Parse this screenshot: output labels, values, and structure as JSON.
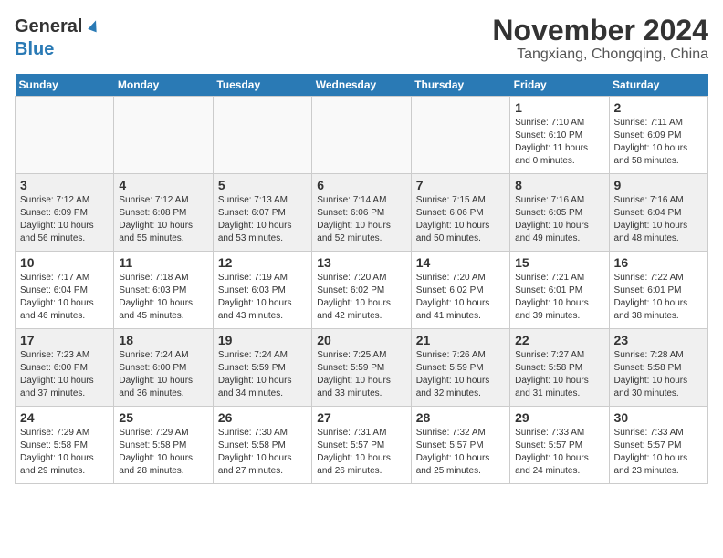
{
  "header": {
    "logo_general": "General",
    "logo_blue": "Blue",
    "title": "November 2024",
    "location": "Tangxiang, Chongqing, China"
  },
  "calendar": {
    "days_of_week": [
      "Sunday",
      "Monday",
      "Tuesday",
      "Wednesday",
      "Thursday",
      "Friday",
      "Saturday"
    ],
    "weeks": [
      [
        {
          "day": "",
          "info": ""
        },
        {
          "day": "",
          "info": ""
        },
        {
          "day": "",
          "info": ""
        },
        {
          "day": "",
          "info": ""
        },
        {
          "day": "",
          "info": ""
        },
        {
          "day": "1",
          "info": "Sunrise: 7:10 AM\nSunset: 6:10 PM\nDaylight: 11 hours\nand 0 minutes."
        },
        {
          "day": "2",
          "info": "Sunrise: 7:11 AM\nSunset: 6:09 PM\nDaylight: 10 hours\nand 58 minutes."
        }
      ],
      [
        {
          "day": "3",
          "info": "Sunrise: 7:12 AM\nSunset: 6:09 PM\nDaylight: 10 hours\nand 56 minutes."
        },
        {
          "day": "4",
          "info": "Sunrise: 7:12 AM\nSunset: 6:08 PM\nDaylight: 10 hours\nand 55 minutes."
        },
        {
          "day": "5",
          "info": "Sunrise: 7:13 AM\nSunset: 6:07 PM\nDaylight: 10 hours\nand 53 minutes."
        },
        {
          "day": "6",
          "info": "Sunrise: 7:14 AM\nSunset: 6:06 PM\nDaylight: 10 hours\nand 52 minutes."
        },
        {
          "day": "7",
          "info": "Sunrise: 7:15 AM\nSunset: 6:06 PM\nDaylight: 10 hours\nand 50 minutes."
        },
        {
          "day": "8",
          "info": "Sunrise: 7:16 AM\nSunset: 6:05 PM\nDaylight: 10 hours\nand 49 minutes."
        },
        {
          "day": "9",
          "info": "Sunrise: 7:16 AM\nSunset: 6:04 PM\nDaylight: 10 hours\nand 48 minutes."
        }
      ],
      [
        {
          "day": "10",
          "info": "Sunrise: 7:17 AM\nSunset: 6:04 PM\nDaylight: 10 hours\nand 46 minutes."
        },
        {
          "day": "11",
          "info": "Sunrise: 7:18 AM\nSunset: 6:03 PM\nDaylight: 10 hours\nand 45 minutes."
        },
        {
          "day": "12",
          "info": "Sunrise: 7:19 AM\nSunset: 6:03 PM\nDaylight: 10 hours\nand 43 minutes."
        },
        {
          "day": "13",
          "info": "Sunrise: 7:20 AM\nSunset: 6:02 PM\nDaylight: 10 hours\nand 42 minutes."
        },
        {
          "day": "14",
          "info": "Sunrise: 7:20 AM\nSunset: 6:02 PM\nDaylight: 10 hours\nand 41 minutes."
        },
        {
          "day": "15",
          "info": "Sunrise: 7:21 AM\nSunset: 6:01 PM\nDaylight: 10 hours\nand 39 minutes."
        },
        {
          "day": "16",
          "info": "Sunrise: 7:22 AM\nSunset: 6:01 PM\nDaylight: 10 hours\nand 38 minutes."
        }
      ],
      [
        {
          "day": "17",
          "info": "Sunrise: 7:23 AM\nSunset: 6:00 PM\nDaylight: 10 hours\nand 37 minutes."
        },
        {
          "day": "18",
          "info": "Sunrise: 7:24 AM\nSunset: 6:00 PM\nDaylight: 10 hours\nand 36 minutes."
        },
        {
          "day": "19",
          "info": "Sunrise: 7:24 AM\nSunset: 5:59 PM\nDaylight: 10 hours\nand 34 minutes."
        },
        {
          "day": "20",
          "info": "Sunrise: 7:25 AM\nSunset: 5:59 PM\nDaylight: 10 hours\nand 33 minutes."
        },
        {
          "day": "21",
          "info": "Sunrise: 7:26 AM\nSunset: 5:59 PM\nDaylight: 10 hours\nand 32 minutes."
        },
        {
          "day": "22",
          "info": "Sunrise: 7:27 AM\nSunset: 5:58 PM\nDaylight: 10 hours\nand 31 minutes."
        },
        {
          "day": "23",
          "info": "Sunrise: 7:28 AM\nSunset: 5:58 PM\nDaylight: 10 hours\nand 30 minutes."
        }
      ],
      [
        {
          "day": "24",
          "info": "Sunrise: 7:29 AM\nSunset: 5:58 PM\nDaylight: 10 hours\nand 29 minutes."
        },
        {
          "day": "25",
          "info": "Sunrise: 7:29 AM\nSunset: 5:58 PM\nDaylight: 10 hours\nand 28 minutes."
        },
        {
          "day": "26",
          "info": "Sunrise: 7:30 AM\nSunset: 5:58 PM\nDaylight: 10 hours\nand 27 minutes."
        },
        {
          "day": "27",
          "info": "Sunrise: 7:31 AM\nSunset: 5:57 PM\nDaylight: 10 hours\nand 26 minutes."
        },
        {
          "day": "28",
          "info": "Sunrise: 7:32 AM\nSunset: 5:57 PM\nDaylight: 10 hours\nand 25 minutes."
        },
        {
          "day": "29",
          "info": "Sunrise: 7:33 AM\nSunset: 5:57 PM\nDaylight: 10 hours\nand 24 minutes."
        },
        {
          "day": "30",
          "info": "Sunrise: 7:33 AM\nSunset: 5:57 PM\nDaylight: 10 hours\nand 23 minutes."
        }
      ]
    ]
  }
}
